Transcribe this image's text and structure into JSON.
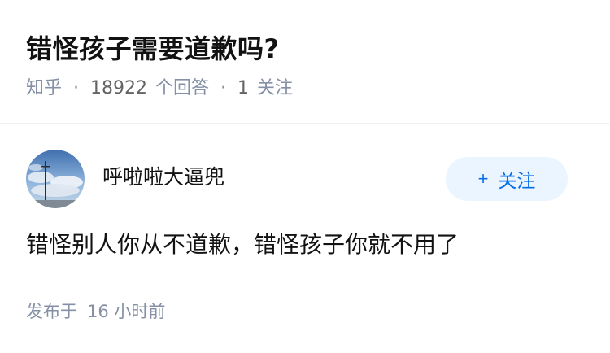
{
  "question": {
    "title": "错怪孩子需要道歉吗?",
    "meta": {
      "site": "知乎",
      "answer_count": "18922",
      "answer_count_label": "个回答",
      "follow_count": "1",
      "follow_label": "关注"
    }
  },
  "answer": {
    "author": {
      "name": "呼啦啦大逼兜",
      "avatar_icon": "sky-landscape-avatar"
    },
    "follow_button": {
      "icon": "plus-icon",
      "plus": "+",
      "label": "关注"
    },
    "content": "错怪别人你从不道歉，错怪孩子你就不用了",
    "published": {
      "label": "发布于",
      "time": "16 小时前"
    }
  },
  "colors": {
    "meta_gray": "#8590a6",
    "accent_blue": "#056de8",
    "follow_bg": "#ebf5ff"
  }
}
